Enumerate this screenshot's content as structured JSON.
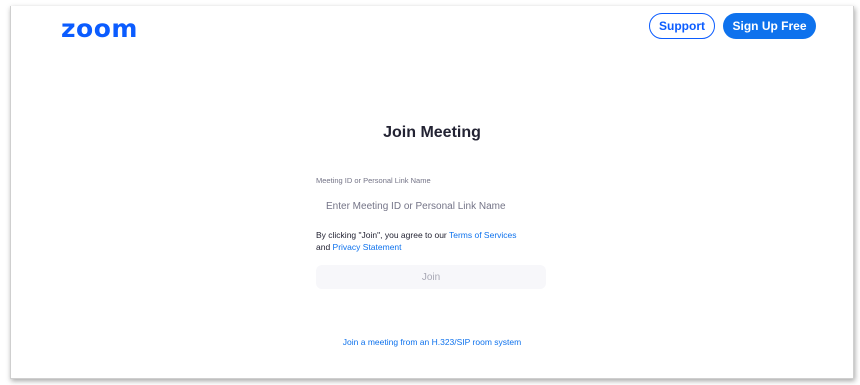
{
  "header": {
    "logo_text": "zoom",
    "support_label": "Support",
    "signup_label": "Sign Up Free"
  },
  "main": {
    "title": "Join Meeting",
    "field_label": "Meeting ID or Personal Link Name",
    "field_placeholder": "Enter Meeting ID or Personal Link Name",
    "field_value": "",
    "agreement_prefix": "By clicking \"Join\", you agree to our ",
    "terms_link": "Terms of Services",
    "agreement_middle": "and ",
    "privacy_link": "Privacy Statement",
    "join_label": "Join",
    "sip_link": "Join a meeting from an H.323/SIP room system"
  },
  "colors": {
    "brand": "#0b5cff",
    "primary_button": "#0e72ed",
    "join_disabled_bg": "#f7f7fa",
    "text": "#232333"
  }
}
